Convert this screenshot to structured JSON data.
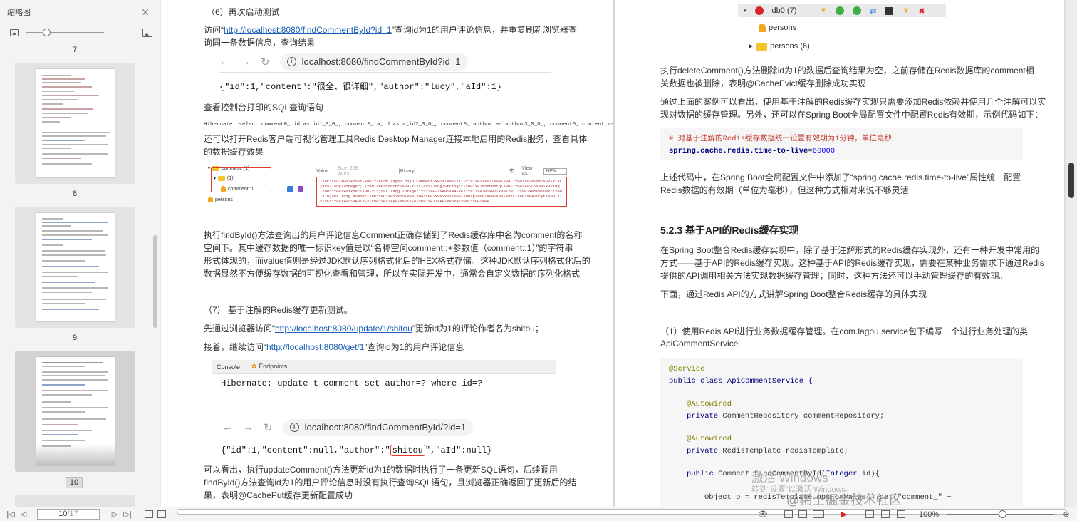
{
  "sidebar": {
    "title": "缩略图",
    "pages": [
      {
        "number": "7"
      },
      {
        "number": "8"
      },
      {
        "number": "9"
      },
      {
        "number": "10"
      }
    ]
  },
  "left_page": {
    "step6_title": "（6）再次启动测试",
    "visit_prefix": "访问“",
    "visit_link": "http://localhost:8080/findCommentById?id=1",
    "visit_suffix": "”查询id为1的用户评论信息，并重复刷新浏览器查",
    "visit_line2": "询同一条数据信息，查询结果",
    "browser1_url": "localhost:8080/findCommentById?id=1",
    "json1": "{\"id\":1,\"content\":\"很全、很详细\",\"author\":\"lucy\",\"aId\":1}",
    "sql_caption": "查看控制台打印的SQL查询语句",
    "sql_log": "Hibernate: select comment0_.id as id1_0_0_, comment0_.a_id as a_id2_0_0_, comment0_.author as author3_0_0_, comment0_.content as content4_0_0_",
    "rdm_intro_l1": "还可以打开Redis客户端可视化管理工具Redis Desktop Manager连接本地启用的Redis服务，查看具体",
    "rdm_intro_l2": "的数据缓存效果",
    "rdm_tree": {
      "root": "comment (1)",
      "folder": "(1)",
      "key": "comment::1",
      "other": "persons"
    },
    "rdm_value_label": "Value:",
    "rdm_value_size": "Size: 258 bytes",
    "rdm_binary": "[Binary]",
    "rdm_viewas": "View as:",
    "rdm_hex": "HEX",
    "rdm_hex_content": "\\xAC\\xED\\x00\\x05sr\\x00\\x16com.lagou.pojo.Comment\\xBCX\\x97\\x11\\x16\\xF2\\x02\\x00\\x04L\\x00\\x03aIdt\\x00\\x13Ljava/lang/Integer;L\\x00\\x06authort\\x00\\x12Ljava/lang/String;L\\x00\\x07contentq\\x00~\\x00\\x02L\\x00\\x02idq\\x00~\\x00\\x01xpsr\\x00\\x11java.lang.Integer\\x12\\xE2\\xA0\\xA4\\xF7\\x81\\x878\\x02\\x00\\x01I\\x00\\x05valuexr\\x00\\x10java.lang.Number\\x86\\xAC\\x95\\x1D\\x0B\\x94\\xE0\\x8B\\x02\\x00\\x00xp\\x00\\x00\\x00\\x01t\\x00\\x04lucyt\\x00\\x12\\xE5\\x88\\xE5\\xA8\\xE2\\x80\\xE5\\x8E\\x88\\xE6\\x88\\xE7\\xA9\\x86xq\\x00~\\x00\\x08",
    "para_find_l1": "执行findById()方法查询出的用户评论信息Comment正确存储到了Redis缓存库中名为comment的名称",
    "para_find_l2": "空间下。其中缓存数据的唯一标识key值是以“名称空间comment::+参数值（comment::1）”的字符串",
    "para_find_l3": "形式体现的，而value值则是经过JDK默认序列格式化后的HEX格式存储。这种JDK默认序列格式化后的",
    "para_find_l4": "数据显然不方便缓存数据的可视化查看和管理，所以在实际开发中，通常会自定义数据的序列化格式",
    "step7_title": "（7） 基于注解的Redis缓存更新测试。",
    "update_prefix": "先通过浏览器访问“",
    "update_link": "http://localhost:8080/update/1/shitou",
    "update_suffix": "”更新id为1的评论作者名为shitou；",
    "then_prefix": "接着，继续访问“",
    "then_link": "http://localhost:8080/get/1",
    "then_suffix": "”查询id为1的用户评论信息",
    "console_tab1": "Console",
    "console_tab2": "Endpoints",
    "console_cmd": "Hibernate: update t_comment set author=? where id=?",
    "browser2_url": "localhost:8080/findCommentById/?id=1",
    "json2_prefix": "{\"id\":1,\"content\":null,\"author\":\"",
    "json2_highlight": "shitou",
    "json2_suffix": "\",\"aId\":null}",
    "para_update_l1": "可以看出，执行updateComment()方法更新id为1的数据时执行了一条更新SQL语句，后续调用",
    "para_update_l2": "findById()方法查询id为1的用户评论信息时没有执行查询SQL语句，且浏览器正确返回了更新后的结",
    "para_update_l3": "果，表明@CachePut缓存更新配置成功"
  },
  "right_page": {
    "rdm_db": "db0 (7)",
    "rdm_key1": "persons",
    "rdm_folder": "persons (6)",
    "para_delete_l1": "执行deleteComment()方法删除id为1的数据后查询结果为空，之前存储在Redis数据库的comment相",
    "para_delete_l2": "关数据也被删除，表明@CacheEvict缓存删除成功实现",
    "para_case_l1": "通过上面的案例可以看出，使用基于注解的Redis缓存实现只需要添加Redis依赖并使用几个注解可以实",
    "para_case_l2": "现对数据的缓存管理。另外，还可以在Spring Boot全局配置文件中配置Redis有效期，示例代码如下：",
    "code1_comment": "# 对基于注解的Redis缓存数据统一设置有效期为1分钟，单位毫秒",
    "code1_prop": "spring.cache.redis.time-to-live",
    "code1_eq": "=",
    "code1_val": "60000",
    "para_config_l1": "上述代码中，在Spring Boot全局配置文件中添加了“spring.cache.redis.time-to-live”属性统一配置",
    "para_config_l2": "Redis数据的有效期（单位为毫秒），但这种方式相对来说不够灵活",
    "section_title": "5.2.3 基于API的Redis缓存实现",
    "para_api_l1": "在Spring Boot整合Redis缓存实现中，除了基于注解形式的Redis缓存实现外，还有一种开发中常用的",
    "para_api_l2": "方式——基于API的Redis缓存实现。这种基于API的Redis缓存实现，需要在某种业务需求下通过Redis",
    "para_api_l3": "提供的API调用相关方法实现数据缓存管理；同时，这种方法还可以手动管理缓存的有效期。",
    "para_below": "下面，通过Redis API的方式讲解Spring Boot整合Redis缓存的具体实现",
    "step1_l1": "（1）使用Redis API进行业务数据缓存管理。在com.lagou.service包下编写一个进行业务处理的类",
    "step1_l2": "ApiCommentService",
    "code2": {
      "service_ann": "@Service",
      "class_kw": "public class ",
      "class_name": "ApiCommentService {",
      "autowired1": "@Autowired",
      "field1_kw": "private ",
      "field1": "CommentRepository commentRepository;",
      "autowired2": "@Autowired",
      "field2_kw": "private ",
      "field2": "RedisTemplate redisTemplate;",
      "method_kw": "public ",
      "method_sig": "Comment findCommentById(",
      "method_type": "Integer ",
      "method_param": "id){",
      "body_line": "Object o = redisTemplate.opsForValue().get(\"comment_\" +"
    }
  },
  "watermark": {
    "activate": "激活 Windows",
    "goto_settings": "转到“设置”以激活 Windows。",
    "community": "@稀土掘金技术社区"
  },
  "statusbar": {
    "current_page": "10",
    "total_pages": "/17",
    "zoom": "100%"
  }
}
